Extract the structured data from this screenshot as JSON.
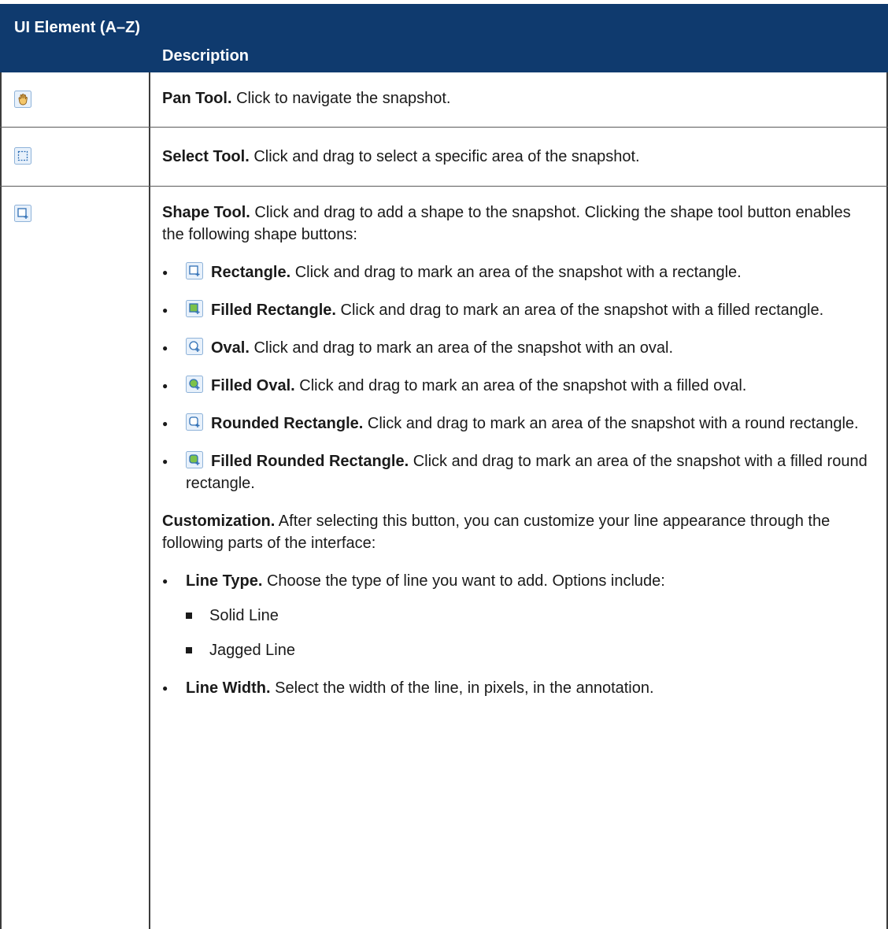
{
  "header": {
    "col1": "UI Element (A–Z)",
    "col2": "Description"
  },
  "rows": {
    "pan": {
      "icon": "hand-pan-icon",
      "title": "Pan Tool.",
      "text": " Click to navigate the snapshot."
    },
    "select": {
      "icon": "select-marquee-icon",
      "title": "Select Tool.",
      "text": " Click and drag to select a specific area of the snapshot."
    },
    "shape": {
      "icon": "shape-rectangle-icon",
      "title": "Shape Tool.",
      "text": " Click and drag to add a shape to the snapshot. Clicking the shape tool button enables the following shape buttons:",
      "buttons": [
        {
          "icon": "rectangle-icon",
          "title": "Rectangle.",
          "text": " Click and drag to mark an area of the snapshot with a rectangle."
        },
        {
          "icon": "filled-rectangle-icon",
          "title": "Filled Rectangle.",
          "text": " Click and drag to mark an area of the snapshot with a filled rectangle."
        },
        {
          "icon": "oval-icon",
          "title": "Oval.",
          "text": " Click and drag to mark an area of the snapshot with an oval."
        },
        {
          "icon": "filled-oval-icon",
          "title": "Filled Oval.",
          "text": " Click and drag to mark an area of the snapshot with a filled oval."
        },
        {
          "icon": "rounded-rectangle-icon",
          "title": "Rounded Rectangle.",
          "text": " Click and drag to mark an area of the snapshot with a round rectangle."
        },
        {
          "icon": "filled-rounded-rectangle-icon",
          "title": "Filled Rounded Rectangle.",
          "text": " Click and drag to mark an area of the snapshot with a filled round rectangle."
        }
      ],
      "customization": {
        "title": "Customization.",
        "text": " After selecting this button, you can customize your line appearance through the following parts of the interface:",
        "line_type": {
          "title": "Line Type.",
          "text": " Choose the type of line you want to add. Options include:",
          "options": [
            "Solid Line",
            "Jagged Line"
          ]
        },
        "line_width": {
          "title": "Line Width.",
          "text": " Select the width of the line, in pixels, in the annotation."
        }
      }
    }
  },
  "colors": {
    "header_bg": "#0f3a6e",
    "header_text": "#ffffff",
    "icon_blue": "#2f7fd0",
    "icon_fill_green": "#7cc24a"
  }
}
